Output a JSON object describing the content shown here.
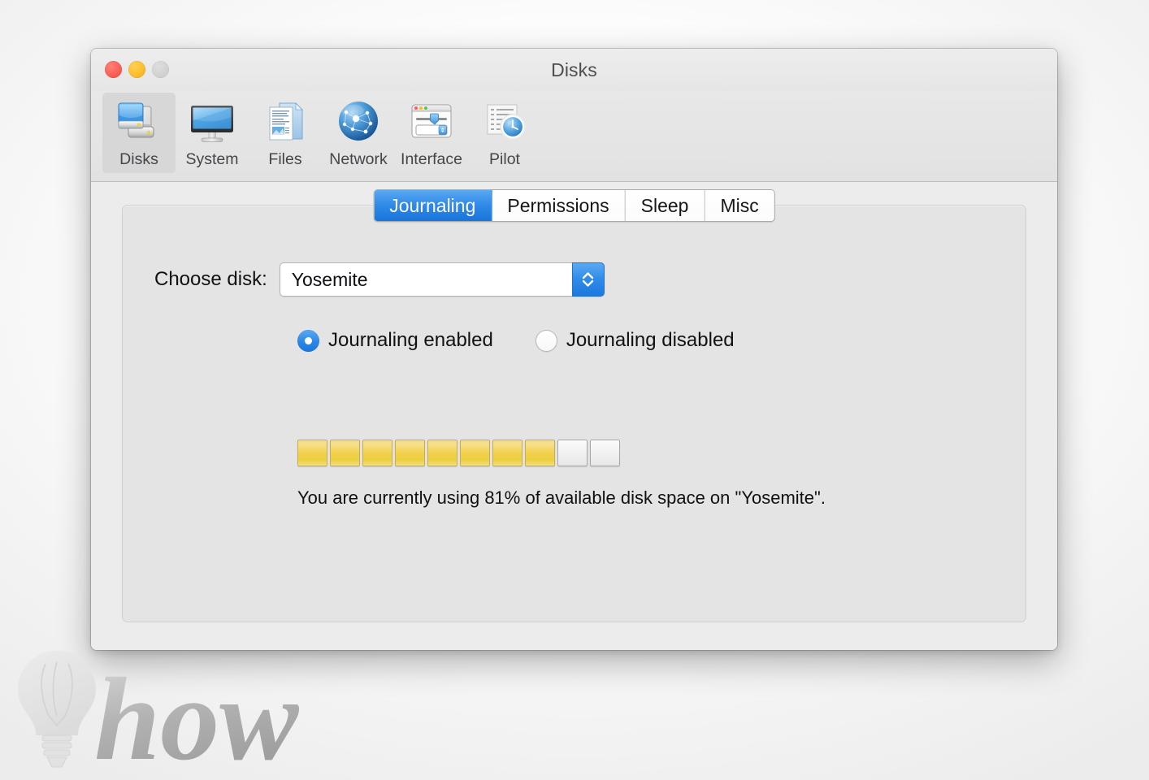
{
  "window": {
    "title": "Disks",
    "controls": [
      {
        "name": "close",
        "color": "#fa5f57"
      },
      {
        "name": "minimize",
        "color": "#fcbd2c"
      },
      {
        "name": "zoom",
        "color": "#d2d2d2"
      }
    ]
  },
  "toolbar": {
    "items": [
      {
        "id": "disks",
        "label": "Disks",
        "icon": "hard-drive-icon",
        "selected": true
      },
      {
        "id": "system",
        "label": "System",
        "icon": "display-icon",
        "selected": false
      },
      {
        "id": "files",
        "label": "Files",
        "icon": "documents-icon",
        "selected": false
      },
      {
        "id": "network",
        "label": "Network",
        "icon": "globe-network-icon",
        "selected": false
      },
      {
        "id": "interface",
        "label": "Interface",
        "icon": "window-slider-icon",
        "selected": false
      },
      {
        "id": "pilot",
        "label": "Pilot",
        "icon": "clock-list-icon",
        "selected": false
      }
    ]
  },
  "tabs": [
    {
      "id": "journaling",
      "label": "Journaling",
      "active": true
    },
    {
      "id": "permissions",
      "label": "Permissions",
      "active": false
    },
    {
      "id": "sleep",
      "label": "Sleep",
      "active": false
    },
    {
      "id": "misc",
      "label": "Misc",
      "active": false
    }
  ],
  "form": {
    "disk_label": "Choose disk:",
    "disk_selected": "Yosemite",
    "disk_options": [
      "Yosemite"
    ],
    "radios": [
      {
        "id": "journaling-enabled",
        "label": "Journaling enabled",
        "selected": true
      },
      {
        "id": "journaling-disabled",
        "label": "Journaling disabled",
        "selected": false
      }
    ]
  },
  "capacity": {
    "percent_used": 81,
    "segments_total": 10,
    "segments_filled": 8,
    "note": "You are currently using 81% of available disk space on \"Yosemite\".",
    "fill_color": "#eccf3f",
    "empty_color": "#f0f0f0"
  },
  "watermark": {
    "text": "how",
    "icon": "lightbulb-icon"
  },
  "theme": {
    "accent": "#2f8ae8",
    "window_bg": "#ececec",
    "panel_bg": "#e4e4e4"
  }
}
